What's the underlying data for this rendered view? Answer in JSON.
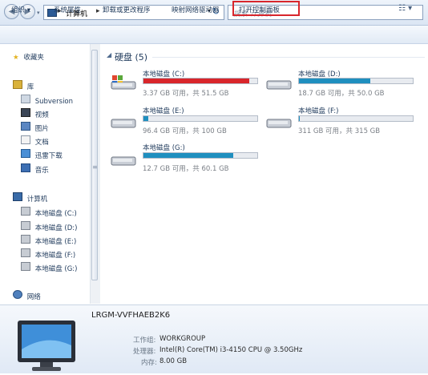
{
  "address": {
    "path": [
      "计算机"
    ],
    "search_placeholder": "搜索 计算机"
  },
  "toolbar": {
    "organize": "组织 ▾",
    "system_properties": "系统属性",
    "uninstall": "卸载或更改程序",
    "map_drive": "映射网络驱动器",
    "control_panel": "打开控制面板",
    "view_icon": "view-options-icon"
  },
  "sidebar": {
    "favorites": "收藏夹",
    "libraries": "库",
    "lib_items": [
      "Subversion",
      "视频",
      "图片",
      "文档",
      "迅雷下载",
      "音乐"
    ],
    "computer": "计算机",
    "drives": [
      "本地磁盘 (C:)",
      "本地磁盘 (D:)",
      "本地磁盘 (E:)",
      "本地磁盘 (F:)",
      "本地磁盘 (G:)"
    ],
    "network": "网络"
  },
  "main": {
    "group_title": "硬盘 (5)",
    "drives": [
      {
        "name": "本地磁盘 (C:)",
        "free": "3.37 GB 可用，共 51.5 GB",
        "used_fraction": 0.93,
        "color": "#d9262b"
      },
      {
        "name": "本地磁盘 (D:)",
        "free": "18.7 GB 可用，共 50.0 GB",
        "used_fraction": 0.63,
        "color": "#1f8fbf"
      },
      {
        "name": "本地磁盘 (E:)",
        "free": "96.4 GB 可用，共 100 GB",
        "used_fraction": 0.04,
        "color": "#1f8fbf"
      },
      {
        "name": "本地磁盘 (F:)",
        "free": "311 GB 可用，共 315 GB",
        "used_fraction": 0.01,
        "color": "#1f8fbf"
      },
      {
        "name": "本地磁盘 (G:)",
        "free": "12.7 GB 可用，共 60.1 GB",
        "used_fraction": 0.79,
        "color": "#1f8fbf"
      }
    ]
  },
  "details": {
    "computer_name": "LRGM-VVFHAEB2K6",
    "workgroup_label": "工作组:",
    "workgroup": "WORKGROUP",
    "cpu_label": "处理器:",
    "cpu": "Intel(R) Core(TM) i3-4150 CPU @ 3.50GHz",
    "memory_label": "内存:",
    "memory": "8.00 GB"
  }
}
